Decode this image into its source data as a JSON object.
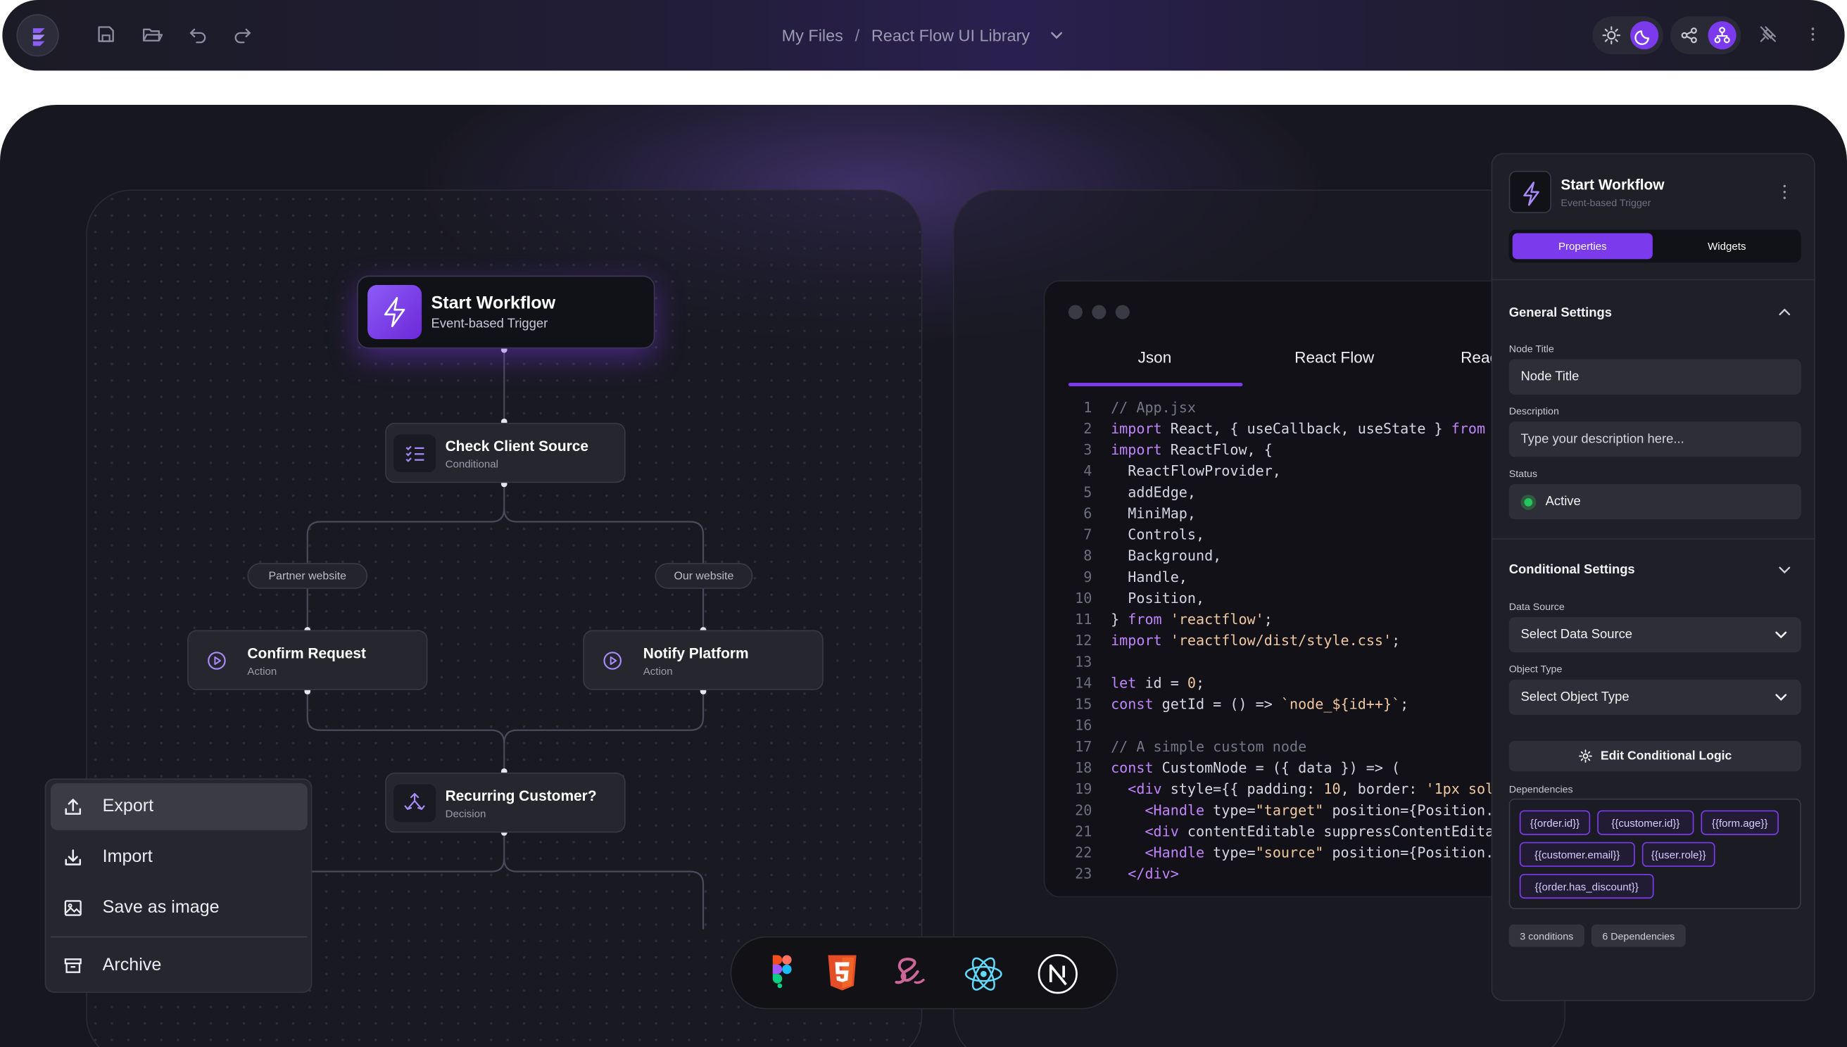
{
  "topbar": {
    "breadcrumb": {
      "root": "My Files",
      "separator": "/",
      "current": "React Flow UI Library"
    }
  },
  "flow": {
    "start": {
      "title": "Start Workflow",
      "subtitle": "Event-based Trigger"
    },
    "nodes": [
      {
        "title": "Check Client Source",
        "subtitle": "Conditional"
      },
      {
        "title": "Confirm Request",
        "subtitle": "Action"
      },
      {
        "title": "Notify Platform",
        "subtitle": "Action"
      },
      {
        "title": "Recurring Customer?",
        "subtitle": "Decision"
      }
    ],
    "edge_labels": [
      "Partner website",
      "Our website"
    ]
  },
  "context_menu": {
    "items": [
      {
        "label": "Export",
        "icon": "upload-icon"
      },
      {
        "label": "Import",
        "icon": "download-icon"
      },
      {
        "label": "Save as image",
        "icon": "image-icon"
      },
      {
        "label": "Archive",
        "icon": "archive-icon"
      }
    ]
  },
  "code_panel": {
    "tabs": [
      "Json",
      "React Flow",
      "Reac"
    ],
    "active_tab": "Json",
    "line_numbers": [
      "1",
      "2",
      "3",
      "4",
      "5",
      "6",
      "7",
      "8",
      "9",
      "10",
      "11",
      "12",
      "13",
      "14",
      "15",
      "16",
      "17",
      "18",
      "19",
      "20",
      "21",
      "22",
      "23"
    ]
  },
  "properties": {
    "title": "Start Workflow",
    "subtitle": "Event-based Trigger",
    "tabs": {
      "properties": "Properties",
      "widgets": "Widgets"
    },
    "general": {
      "title": "General Settings",
      "node_title_label": "Node Title",
      "node_title_value": "Node Title",
      "description_label": "Description",
      "description_placeholder": "Type your description here...",
      "status_label": "Status",
      "status_value": "Active"
    },
    "conditional": {
      "title": "Conditional Settings",
      "data_source_label": "Data Source",
      "data_source_value": "Select Data Source",
      "object_type_label": "Object Type",
      "object_type_value": "Select Object Type",
      "edit_button": "Edit Conditional Logic",
      "dependencies_label": "Dependencies",
      "dependencies": [
        "{{order.id}}",
        "{{customer.id}}",
        "{{form.age}}",
        "{{customer.email}}",
        "{{user.role}}",
        "{{order.has_discount}}"
      ],
      "badges": [
        "3 conditions",
        "6 Dependencies"
      ]
    }
  },
  "tech_stack": [
    "figma-icon",
    "html5-icon",
    "sass-icon",
    "react-icon",
    "nextjs-icon"
  ],
  "colors": {
    "accent": "#7c3aed",
    "status_active": "#22c55e",
    "background": "#17171f"
  }
}
